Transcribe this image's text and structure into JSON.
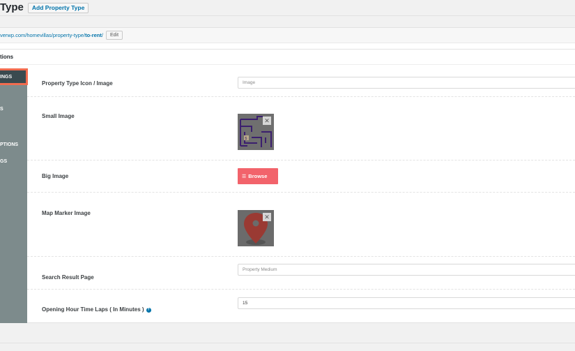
{
  "header": {
    "title": "Type",
    "add_button": "Add Property Type"
  },
  "permalink": {
    "url_prefix": "verwp.com/homevillas/property-type/",
    "slug": "to-rent",
    "trailing": "/",
    "edit_label": "Edit"
  },
  "metabox": {
    "title": "tions"
  },
  "sidebar": {
    "items": [
      {
        "label": "INGS",
        "active": true
      },
      {
        "label": "S"
      },
      {
        "label": "PTIONS"
      },
      {
        "label": "GS"
      }
    ]
  },
  "fields": {
    "icon_image": {
      "label": "Property Type Icon / Image",
      "value": "Image"
    },
    "small_image": {
      "label": "Small Image",
      "remove_symbol": "✕"
    },
    "big_image": {
      "label": "Big Image",
      "browse_label": "Browse"
    },
    "map_marker": {
      "label": "Map Marker Image",
      "remove_symbol": "✕"
    },
    "search_result": {
      "label": "Search Result Page",
      "value": "Property Medium"
    },
    "opening_hour": {
      "label": "Opening Hour Time Laps ( In Minutes )",
      "value": "15",
      "help_symbol": "?"
    }
  },
  "colors": {
    "accent": "#f2636b",
    "sidebar_bg": "#7d8b8c",
    "active_border": "#f26c4f",
    "link": "#0073aa"
  },
  "icons": [
    "close-icon",
    "list-icon",
    "help-icon",
    "map-marker-icon",
    "floorplan-icon"
  ]
}
